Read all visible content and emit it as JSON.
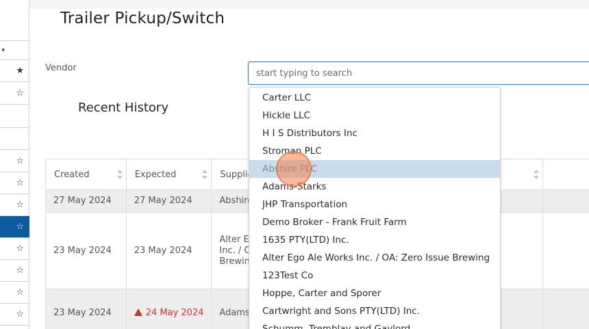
{
  "page": {
    "title": "Trailer Pickup/Switch"
  },
  "vendor": {
    "label": "Vendor",
    "placeholder": "start typing to search"
  },
  "recent": {
    "title": "Recent History"
  },
  "table": {
    "columns": [
      "Created",
      "Expected",
      "Supplier",
      "",
      ""
    ],
    "rows": [
      {
        "created": "27 May 2024",
        "expected": "27 May 2024",
        "supplier": "Abshire",
        "warning": false
      },
      {
        "created": "23 May 2024",
        "expected": "23 May 2024",
        "supplier_lines": [
          "Alter Eg",
          "Inc. / O",
          "Brewing"
        ],
        "warning": false
      },
      {
        "created": "23 May 2024",
        "expected": "24 May 2024",
        "supplier": "Adams-",
        "warning": true
      }
    ]
  },
  "dropdown": {
    "options": [
      "Carter LLC",
      "Hickle LLC",
      "H I S Distributors Inc",
      "Stroman PLC",
      "Abshire PLC",
      "Adams-Starks",
      "JHP Transportation",
      "Demo Broker - Frank Fruit Farm",
      "1635 PTY(LTD) Inc.",
      "Alter Ego Ale Works Inc. / OA: Zero Issue Brewing",
      "123Test Co",
      "Hoppe, Carter and Sporer",
      "Cartwright and Sons PTY(LTD) Inc.",
      "Schumm, Tremblay and Gaylord"
    ],
    "hovered_index": 4
  },
  "sidebar": {
    "icons": [
      "caret-down-icon",
      "star-filled-icon",
      "star-icon",
      "star-icon",
      "star-icon",
      "star-icon",
      "star-icon",
      "star-icon",
      "star-icon",
      "star-icon",
      "star-icon"
    ],
    "glyphs": {
      "star_filled": "★",
      "star": "☆",
      "caret": "▾"
    },
    "active_index": 7,
    "accent_color": "#0b5b9e"
  },
  "colors": {
    "warning": "#c0392b",
    "hover_option": "#c9dced",
    "input_border": "#3a7bc8"
  }
}
